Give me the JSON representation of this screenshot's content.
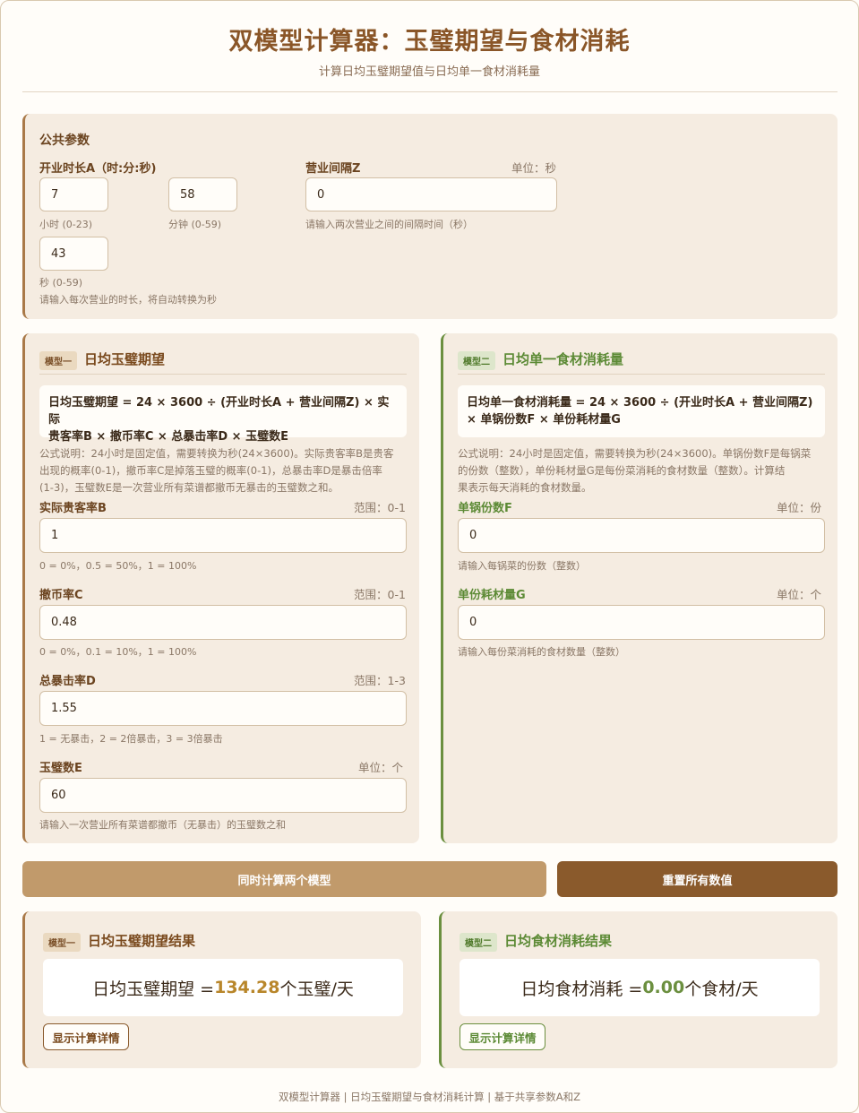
{
  "header": {
    "title": "双模型计算器：玉璧期望与食材消耗",
    "subtitle": "计算日均玉璧期望值与日均单一食材消耗量"
  },
  "common": {
    "title": "公共参数",
    "duration_label": "开业时长A（时:分:秒)",
    "hours_value": "7",
    "hours_hint": "小时 (0-23)",
    "minutes_value": "58",
    "minutes_hint": "分钟 (0-59)",
    "seconds_value": "43",
    "seconds_hint": "秒 (0-59)",
    "duration_hint": "请输入每次营业的时长，将自动转换为秒",
    "interval_label": "营业间隔Z",
    "interval_unit": "单位：秒",
    "interval_value": "0",
    "interval_hint": "请输入两次营业之间的间隔时间（秒）"
  },
  "model1": {
    "badge": "模型一",
    "title": "日均玉璧期望",
    "formula_line1": "日均玉璧期望 = 24 × 3600 ÷ (开业时长A + 营业间隔Z) × 实际",
    "formula_line2": "贵客率B × 撤币率C × 总暴击率D × 玉璧数E",
    "desc_line1": "公式说明：24小时是固定值，需要转换为秒(24×3600)。实际贵客率B是贵客",
    "desc_line2": "出现的概率(0-1)，撤币率C是掉落玉璧的概率(0-1)，总暴击率D是暴击倍率",
    "desc_line3": "(1-3)，玉璧数E是一次营业所有菜谱都撤币无暴击的玉璧数之和。",
    "b_label": "实际贵客率B",
    "b_unit": "范围：0-1",
    "b_value": "1",
    "b_hint": "0 = 0%，0.5 = 50%，1 = 100%",
    "c_label": "撤币率C",
    "c_unit": "范围：0-1",
    "c_value": "0.48",
    "c_hint": "0 = 0%，0.1 = 10%，1 = 100%",
    "d_label": "总暴击率D",
    "d_unit": "范围：1-3",
    "d_value": "1.55",
    "d_hint": "1 = 无暴击，2 = 2倍暴击，3 = 3倍暴击",
    "e_label": "玉璧数E",
    "e_unit": "单位：个",
    "e_value": "60",
    "e_hint": "请输入一次营业所有菜谱都撤币（无暴击）的玉璧数之和"
  },
  "model2": {
    "badge": "模型二",
    "title": "日均单一食材消耗量",
    "formula_line1": "日均单一食材消耗量 = 24 × 3600 ÷ (开业时长A + 营业间隔Z)",
    "formula_line2": "× 单锅份数F × 单份耗材量G",
    "desc_line1": "公式说明：24小时是固定值，需要转换为秒(24×3600)。单锅份数F是每锅菜",
    "desc_line2": "的份数（整数），单份耗材量G是每份菜消耗的食材数量（整数）。计算结",
    "desc_line3": "果表示每天消耗的食材数量。",
    "f_label": "单锅份数F",
    "f_unit": "单位：份",
    "f_value": "0",
    "f_hint": "请输入每锅菜的份数（整数）",
    "g_label": "单份耗材量G",
    "g_unit": "单位：个",
    "g_value": "0",
    "g_hint": "请输入每份菜消耗的食材数量（整数）"
  },
  "actions": {
    "calc_label": "同时计算两个模型",
    "reset_label": "重置所有数值"
  },
  "result1": {
    "badge": "模型一",
    "title": "日均玉璧期望结果",
    "prefix": "日均玉璧期望 = ",
    "value": "134.28",
    "suffix": "个玉璧/天",
    "detail_label": "显示计算详情"
  },
  "result2": {
    "badge": "模型二",
    "title": "日均食材消耗结果",
    "prefix": "日均食材消耗 = ",
    "value": "0.00",
    "suffix": "个食材/天",
    "detail_label": "显示计算详情"
  },
  "footer": "双模型计算器 | 日均玉璧期望与食材消耗计算 | 基于共享参数A和Z",
  "colors": {
    "accent_brown": "#a97948",
    "accent_green": "#6b8f3f",
    "gold_value": "#b8862a"
  }
}
